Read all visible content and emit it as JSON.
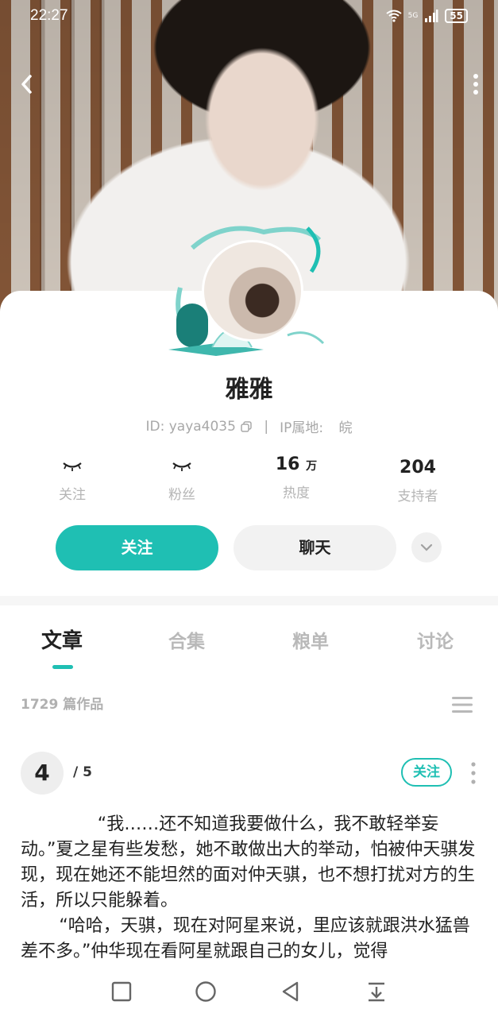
{
  "status_bar": {
    "time": "22:27",
    "network": "5G",
    "battery": "55"
  },
  "profile": {
    "name": "雅雅",
    "id_text": "ID: yaya4035",
    "separator": "|",
    "ip_label": "IP属地:",
    "ip_value": "皖"
  },
  "stats": [
    {
      "value": "",
      "label": "关注",
      "hidden": true
    },
    {
      "value": "",
      "label": "粉丝",
      "hidden": true
    },
    {
      "value": "16",
      "unit": "万",
      "label": "热度"
    },
    {
      "value": "204",
      "label": "支持者"
    }
  ],
  "actions": {
    "follow": "关注",
    "chat": "聊天"
  },
  "tabs": [
    {
      "label": "文章",
      "active": true
    },
    {
      "label": "合集",
      "active": false
    },
    {
      "label": "粮单",
      "active": false
    },
    {
      "label": "讨论",
      "active": false
    }
  ],
  "works": {
    "count_text": "1729 篇作品"
  },
  "chapter": {
    "current": "4",
    "total": "/ 5",
    "follow_label": "关注"
  },
  "article": {
    "paragraphs": [
      "“我……还不知道我要做什么，我不敢轻举妄动。”夏之星有些发愁，她不敢做出大的举动，怕被仲天骐发现，现在她还不能坦然的面对仲天骐，也不想打扰对方的生活，所以只能躲着。",
      "“哈哈，天骐，现在对阿星来说，里应该就跟洪水猛兽差不多。”仲华现在看阿星就跟自己的女儿，觉得"
    ]
  },
  "colors": {
    "accent": "#1fbfb3"
  },
  "icons": [
    "back-icon",
    "more-icon",
    "copy-icon",
    "eye-closed-icon",
    "chevron-down-icon",
    "list-icon",
    "kebab-icon",
    "square-nav-icon",
    "circle-nav-icon",
    "back-nav-icon",
    "download-nav-icon"
  ]
}
